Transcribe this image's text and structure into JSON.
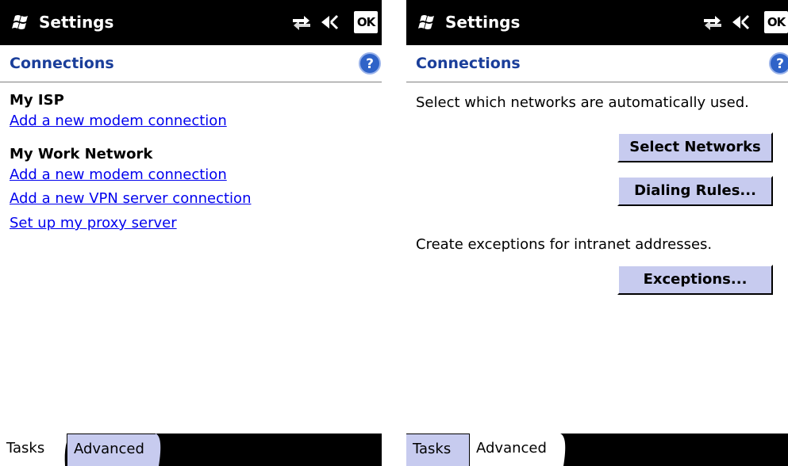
{
  "left": {
    "title": "Settings",
    "ok_label": "OK",
    "header": "Connections",
    "groups": [
      {
        "title": "My ISP",
        "links": [
          "Add a new modem connection"
        ]
      },
      {
        "title": "My Work Network",
        "links": [
          "Add a new modem connection",
          "Add a new VPN server connection",
          "Set up my proxy server"
        ]
      }
    ],
    "tabs": [
      "Tasks",
      "Advanced"
    ],
    "active_tab": "Tasks"
  },
  "right": {
    "title": "Settings",
    "ok_label": "OK",
    "header": "Connections",
    "networks_text": "Select which networks are automatically used.",
    "select_networks_label": "Select Networks",
    "dialing_rules_label": "Dialing Rules...",
    "exceptions_text": "Create exceptions for intranet addresses.",
    "exceptions_label": "Exceptions...",
    "tabs": [
      "Tasks",
      "Advanced"
    ],
    "active_tab": "Advanced"
  },
  "colors": {
    "title_bar": "#000000",
    "header_text": "#1a3e9a",
    "link": "#0000ee",
    "button_face": "#c7cbef",
    "help_icon": "#2f63c8"
  },
  "icons": [
    "windows-logo-icon",
    "connectivity-icon",
    "volume-icon",
    "help-icon"
  ]
}
